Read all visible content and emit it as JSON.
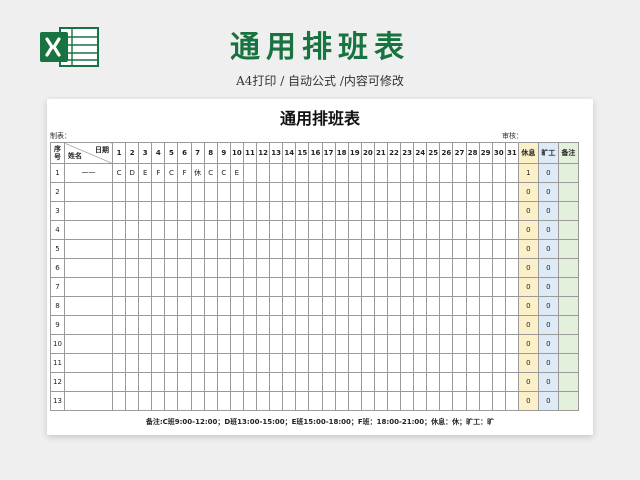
{
  "header": {
    "title": "通用排班表",
    "subtitle": "A4打印 / 自动公式 /内容可修改"
  },
  "sheet": {
    "title": "通用排班表",
    "maker_label": "制表：",
    "reviewer_label": "审核：",
    "headers": {
      "seq": "序号",
      "date": "日期",
      "name": "姓名",
      "days": [
        "1",
        "2",
        "3",
        "4",
        "5",
        "6",
        "7",
        "8",
        "9",
        "10",
        "11",
        "12",
        "13",
        "14",
        "15",
        "16",
        "17",
        "18",
        "19",
        "20",
        "21",
        "22",
        "23",
        "24",
        "25",
        "26",
        "27",
        "28",
        "29",
        "30",
        "31"
      ],
      "rest": "休息",
      "absent": "旷工",
      "note": "备注"
    },
    "rows": [
      {
        "no": "1",
        "name": "一一",
        "days": [
          "C",
          "D",
          "E",
          "F",
          "C",
          "F",
          "休",
          "C",
          "C",
          "E",
          "",
          "",
          "",
          "",
          "",
          "",
          "",
          "",
          "",
          "",
          "",
          "",
          "",
          "",
          "",
          "",
          "",
          "",
          "",
          "",
          ""
        ],
        "rest": "1",
        "absent": "0"
      },
      {
        "no": "2",
        "name": "",
        "days": [],
        "rest": "0",
        "absent": "0"
      },
      {
        "no": "3",
        "name": "",
        "days": [],
        "rest": "0",
        "absent": "0"
      },
      {
        "no": "4",
        "name": "",
        "days": [],
        "rest": "0",
        "absent": "0"
      },
      {
        "no": "5",
        "name": "",
        "days": [],
        "rest": "0",
        "absent": "0"
      },
      {
        "no": "6",
        "name": "",
        "days": [],
        "rest": "0",
        "absent": "0"
      },
      {
        "no": "7",
        "name": "",
        "days": [],
        "rest": "0",
        "absent": "0"
      },
      {
        "no": "8",
        "name": "",
        "days": [],
        "rest": "0",
        "absent": "0"
      },
      {
        "no": "9",
        "name": "",
        "days": [],
        "rest": "0",
        "absent": "0"
      },
      {
        "no": "10",
        "name": "",
        "days": [],
        "rest": "0",
        "absent": "0"
      },
      {
        "no": "11",
        "name": "",
        "days": [],
        "rest": "0",
        "absent": "0"
      },
      {
        "no": "12",
        "name": "",
        "days": [],
        "rest": "0",
        "absent": "0"
      },
      {
        "no": "13",
        "name": "",
        "days": [],
        "rest": "0",
        "absent": "0"
      }
    ],
    "footnote": "备注:C班9:00-12:00；D班13:00-15:00；E班15:00-18:00；F班：18:00-21:00；休息：休；旷工：旷"
  },
  "colors": {
    "brand": "#17733f",
    "rest": "#fbf0c8",
    "absent": "#dfeaf7",
    "note": "#e3f1dc"
  },
  "icons": {
    "logo": "excel-logo-icon"
  }
}
